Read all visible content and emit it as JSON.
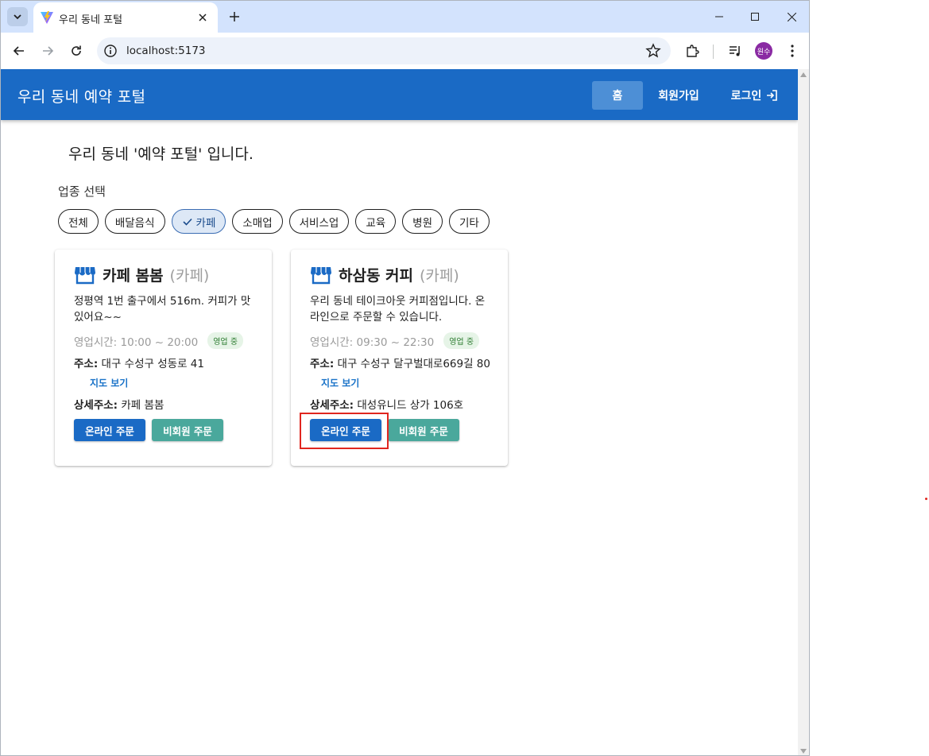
{
  "browser": {
    "tab_title": "우리 동네 포털",
    "url": "localhost:5173",
    "profile_initials": "원수"
  },
  "app": {
    "brand": "우리 동네 예약 포털",
    "nav": {
      "home": "홈",
      "signup": "회원가입",
      "login": "로그인"
    }
  },
  "page": {
    "title": "우리 동네 '예약 포털' 입니다.",
    "filter_label": "업종 선택",
    "chips": [
      "전체",
      "배달음식",
      "카페",
      "소매업",
      "서비스업",
      "교육",
      "병원",
      "기타"
    ],
    "selected_chip": "카페"
  },
  "stores": [
    {
      "name": "카페 봄봄",
      "category": "(카페)",
      "description": "정평역 1번 출구에서 516m. 커피가 맛있어요~~",
      "hours": "영업시간: 10:00 ~ 20:00",
      "status": "영업 중",
      "address_label": "주소:",
      "address": "대구 수성구 성동로 41",
      "map_link": "지도 보기",
      "detail_label": "상세주소:",
      "detail": "카페 봄봄",
      "online_order": "온라인 주문",
      "guest_order": "비회원 주문"
    },
    {
      "name": "하삼동 커피",
      "category": "(카페)",
      "description": "우리 동네 테이크아웃 커피점입니다. 온라인으로 주문할 수 있습니다.",
      "hours": "영업시간: 09:30 ~ 22:30",
      "status": "영업 중",
      "address_label": "주소:",
      "address": "대구 수성구 달구벌대로669길 80",
      "map_link": "지도 보기",
      "detail_label": "상세주소:",
      "detail": "대성유니드 상가 106호",
      "online_order": "온라인 주문",
      "guest_order": "비회원 주문"
    }
  ],
  "colors": {
    "appbar": "#1a6ac5",
    "primary_button": "#1a6ac5",
    "secondary_button": "#4aa89c",
    "open_badge": "#2e7d32",
    "highlight": "#e0261f"
  }
}
